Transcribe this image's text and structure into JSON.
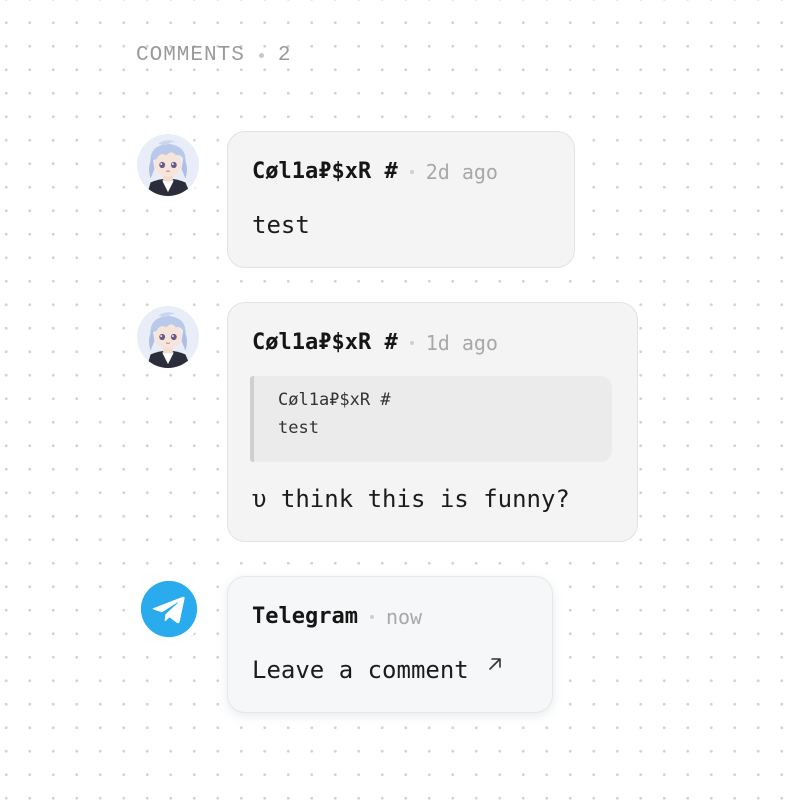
{
  "header": {
    "label": "COMMENTS",
    "count": "2"
  },
  "comments": [
    {
      "author": "Cøl1a₽$xR #",
      "time": "2d ago",
      "text": "test",
      "avatar_icon": "anime-avatar-icon"
    },
    {
      "author": "Cøl1a₽$xR #",
      "time": "1d ago",
      "quote": {
        "author": "Cøl1a₽$xR #",
        "text": "test"
      },
      "text": "υ think this is funny?",
      "avatar_icon": "anime-avatar-icon"
    }
  ],
  "telegram": {
    "author": "Telegram",
    "time": "now",
    "cta": "Leave a comment",
    "cta_icon": "external-arrow-icon",
    "avatar_icon": "telegram-icon",
    "brand_color": "#2AABEE"
  }
}
